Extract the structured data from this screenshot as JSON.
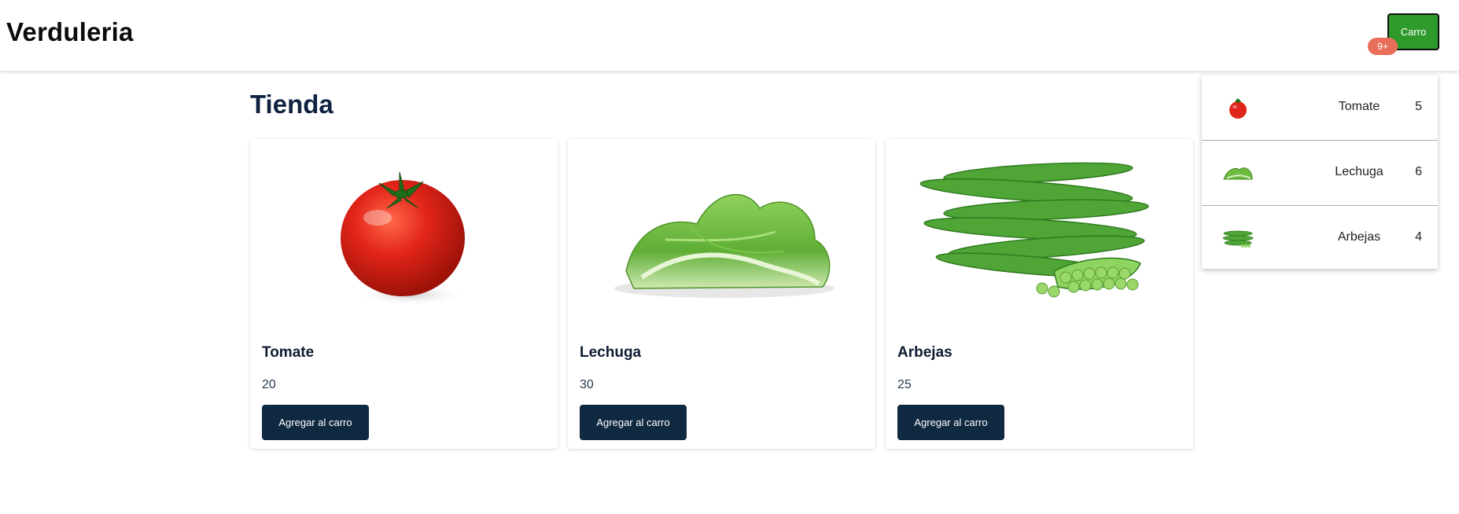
{
  "brand": "Verduleria",
  "cart": {
    "label": "Carro",
    "badge": "9+"
  },
  "page_title": "Tienda",
  "products": [
    {
      "name": "Tomate",
      "price": "20",
      "button": "Agregar al carro",
      "image": "tomato-image"
    },
    {
      "name": "Lechuga",
      "price": "30",
      "button": "Agregar al carro",
      "image": "lettuce-image"
    },
    {
      "name": "Arbejas",
      "price": "25",
      "button": "Agregar al carro",
      "image": "peas-image"
    }
  ],
  "cart_items": [
    {
      "name": "Tomate",
      "qty": "5",
      "image": "tomato-thumb"
    },
    {
      "name": "Lechuga",
      "qty": "6",
      "image": "lettuce-thumb"
    },
    {
      "name": "Arbejas",
      "qty": "4",
      "image": "peas-thumb"
    }
  ],
  "colors": {
    "cart_button": "#2f9a2c",
    "badge": "#e8705a",
    "primary_button": "#0f2941",
    "title": "#0e2240"
  }
}
